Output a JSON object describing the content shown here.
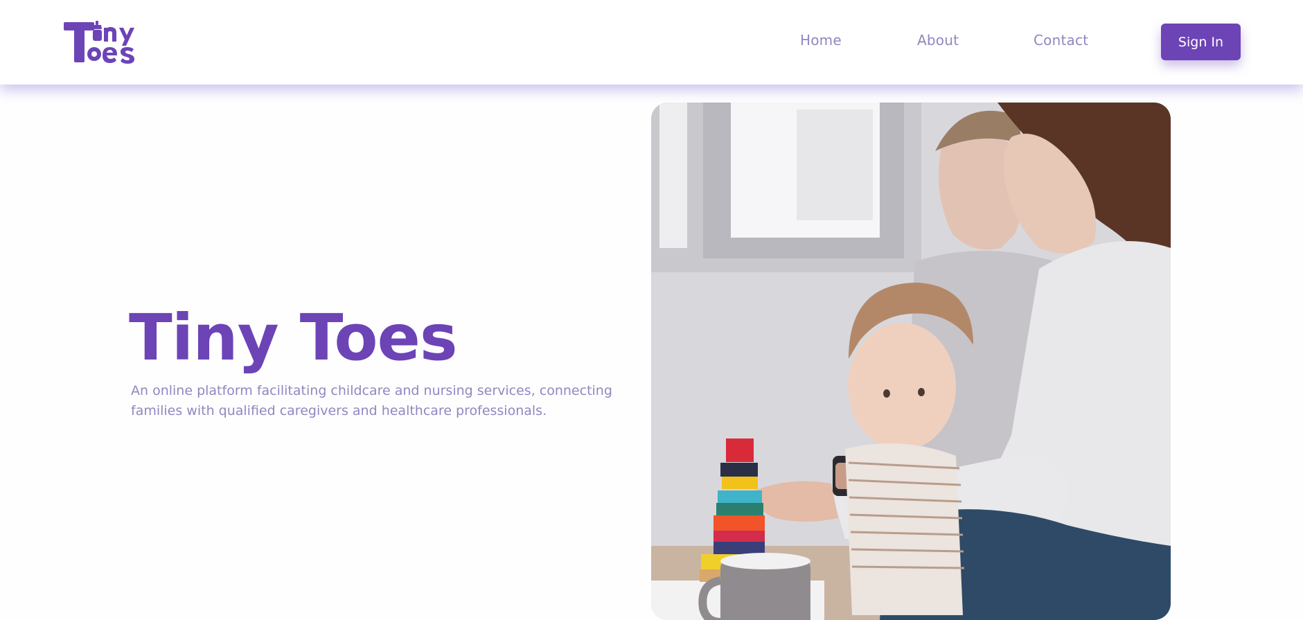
{
  "brand": {
    "logo_text": "Tiny Toes",
    "logo_icon": "baby-bottle-icon",
    "primary_color": "#6c44b6",
    "muted_text_color": "#8e88bf"
  },
  "nav": {
    "links": [
      {
        "label": "Home"
      },
      {
        "label": "About"
      },
      {
        "label": "Contact"
      }
    ],
    "signin_label": "Sign In"
  },
  "hero": {
    "title": "Tiny Toes",
    "description": "An online platform facilitating childcare and nursing services, connecting families with qualified caregivers and healthcare professionals.",
    "image_subject": "parents playing with toddler and stacking blocks"
  }
}
